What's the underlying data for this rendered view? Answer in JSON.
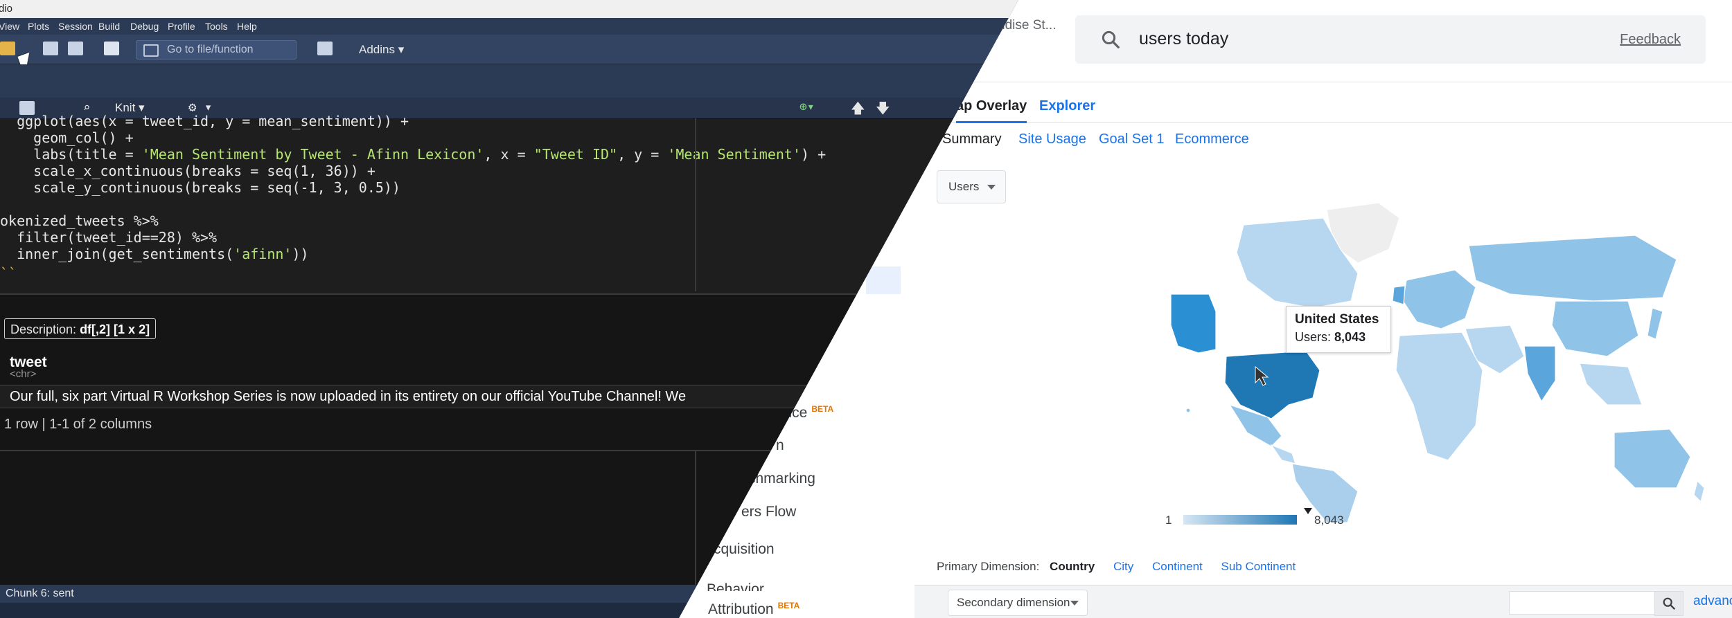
{
  "analytics": {
    "property_name": "ndise St...",
    "search_query": "users today",
    "feedback_label": "Feedback",
    "tabs": [
      "ap Overlay",
      "Explorer"
    ],
    "subtabs": [
      "Summary",
      "Site Usage",
      "Goal Set 1",
      "Ecommerce"
    ],
    "metric_dropdown": "Users",
    "tooltip": {
      "country": "United States",
      "label": "Users:",
      "value": "8,043"
    },
    "legend": {
      "min": "1",
      "max": "8,043"
    },
    "primary_dimension": {
      "label": "Primary Dimension:",
      "selected": "Country",
      "options": [
        "City",
        "Continent",
        "Sub Continent"
      ]
    },
    "secondary_dimension": "Secondary dimension",
    "advanced_link": "advanc",
    "left_nav": [
      {
        "label": "vice",
        "beta": "BETA"
      },
      {
        "label": "n",
        "beta": ""
      },
      {
        "label": "chmarking",
        "beta": ""
      },
      {
        "label": "ers Flow",
        "beta": ""
      },
      {
        "label": "cquisition",
        "beta": ""
      },
      {
        "label": "Behavior",
        "beta": ""
      },
      {
        "label": "Attribution",
        "beta": "BETA"
      }
    ]
  },
  "rstudio": {
    "title": "dio",
    "menu": [
      "View",
      "Plots",
      "Session",
      "Build",
      "Debug",
      "Profile",
      "Tools",
      "Help"
    ],
    "goto_placeholder": "Go to file/function",
    "addins_label": "Addins",
    "knit_label": "Knit",
    "code_lines": [
      {
        "indent": "  ",
        "text": "ggplot(aes(x = tweet_id, y = mean_sentiment)) +"
      },
      {
        "indent": "    ",
        "text": "geom_col() +"
      },
      {
        "indent": "    ",
        "pre": "labs(title = ",
        "s1": "'Mean Sentiment by Tweet - Afinn Lexicon'",
        "mid1": ", x = ",
        "s2": "\"Tweet ID\"",
        "mid2": ", y = ",
        "s3": "'Mean Sentiment'",
        "post": ") +"
      },
      {
        "indent": "    ",
        "text": "scale_x_continuous(breaks = seq(1, 36)) +"
      },
      {
        "indent": "    ",
        "text": "scale_y_continuous(breaks = seq(-1, 3, 0.5))"
      },
      {
        "indent": "",
        "text": ""
      },
      {
        "indent": "",
        "text": "okenized_tweets %>%"
      },
      {
        "indent": "  ",
        "text": "filter(tweet_id==28) %>%"
      },
      {
        "indent": "  ",
        "pre": "inner_join(get_sentiments(",
        "s1": "'afinn'",
        "post": "))"
      },
      {
        "indent": "",
        "text": "``"
      }
    ],
    "output": {
      "description_label": "Description:",
      "description_value": "df[,2] [1 x 2]",
      "column_name": "tweet",
      "column_type": "<chr>",
      "cell": "Our full, six part Virtual R Workshop Series is now uploaded in its entirety on our official YouTube Channel! We",
      "row_info": "1 row | 1-1 of 2 columns"
    },
    "status": "Chunk 6: sent"
  },
  "colors": {
    "map_us": "#1f77b4",
    "map_high": "#2b8fd3",
    "map_mid": "#8fc3e8",
    "map_low": "#cfe3f3",
    "map_none": "#eeeeee",
    "link_blue": "#1a73e8"
  }
}
